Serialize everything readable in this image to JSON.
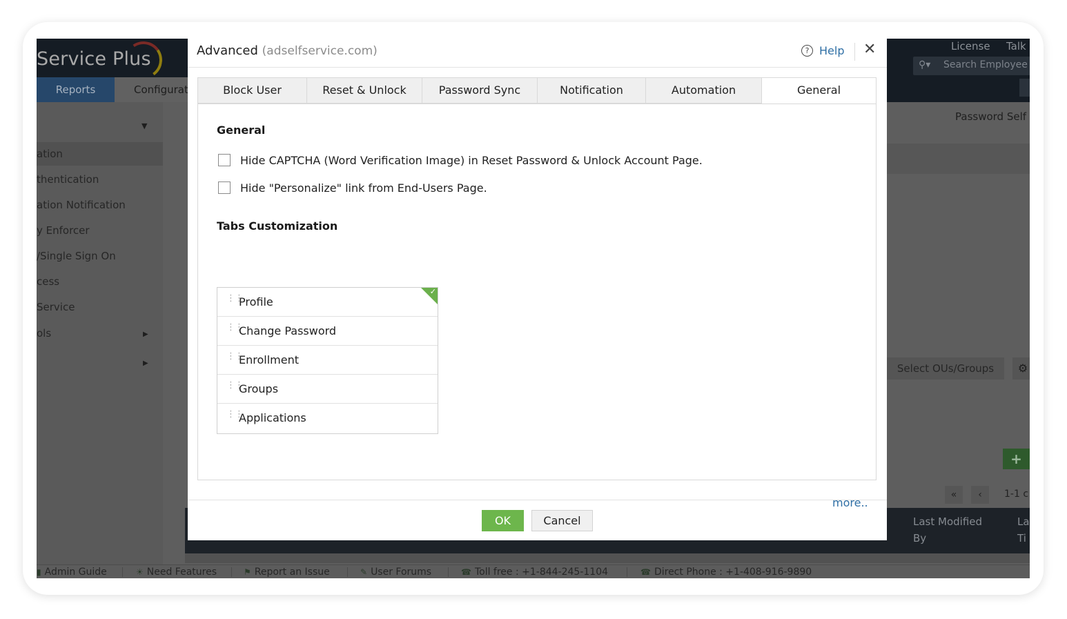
{
  "app": {
    "logo_text": "Service Plus",
    "nav": {
      "reports": "Reports",
      "configuration": "Configurat"
    },
    "top_links": {
      "license": "License",
      "talk": "Talk"
    },
    "search": {
      "placeholder": "Search Employee"
    },
    "sidebar": {
      "items": [
        {
          "label": "ation",
          "active": true
        },
        {
          "label": "thentication"
        },
        {
          "label": "ation Notification"
        },
        {
          "label": "y Enforcer"
        },
        {
          "label": "/Single Sign On"
        },
        {
          "label": "cess"
        },
        {
          "label": "Service"
        },
        {
          "label": "ols",
          "has_submenu": true
        },
        {
          "label": "",
          "has_submenu": true
        }
      ]
    },
    "main": {
      "heading": "Password Self",
      "select_ous_label": "Select OUs/Groups",
      "pager_text": "1-1 c",
      "table_headers": {
        "last_modified_by": "Last Modified By",
        "la_ti": "La Ti"
      }
    },
    "footer": {
      "admin_guide": "Admin Guide",
      "need_features": "Need Features",
      "report_issue": "Report an Issue",
      "user_forums": "User Forums",
      "toll_free": "Toll free : +1-844-245-1104",
      "direct_phone": "Direct Phone : +1-408-916-9890"
    }
  },
  "modal": {
    "title": "Advanced",
    "subtitle": "(adselfservice.com)",
    "help_label": "Help",
    "tabs": [
      {
        "label": "Block User"
      },
      {
        "label": "Reset & Unlock"
      },
      {
        "label": "Password Sync"
      },
      {
        "label": "Notification"
      },
      {
        "label": "Automation"
      },
      {
        "label": "General",
        "active": true
      }
    ],
    "general": {
      "heading": "General",
      "options": [
        {
          "label": "Hide CAPTCHA (Word Verification Image) in Reset Password & Unlock Account Page.",
          "checked": false
        },
        {
          "label": "Hide \"Personalize\" link from End-Users Page.",
          "checked": false
        }
      ]
    },
    "tabs_customization": {
      "heading": "Tabs Customization",
      "items": [
        "Profile",
        "Change Password",
        "Enrollment",
        "Groups",
        "Applications"
      ]
    },
    "more_link": "more..",
    "buttons": {
      "ok": "OK",
      "cancel": "Cancel"
    }
  },
  "colors": {
    "accent_green": "#6db64c",
    "link_blue": "#2f6fa5",
    "dim_overlay": "#5f5f5f"
  }
}
